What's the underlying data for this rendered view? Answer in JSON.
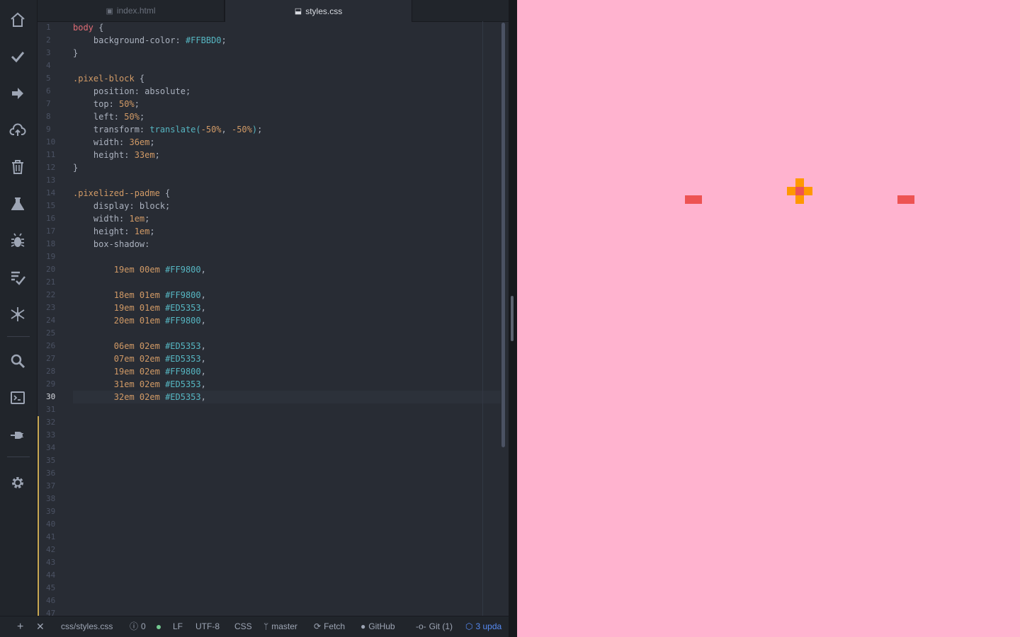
{
  "tabs": [
    {
      "label": "index.html",
      "icon": "html-file-icon",
      "active": false
    },
    {
      "label": "styles.css",
      "icon": "css-file-icon",
      "active": true
    }
  ],
  "activity_icons": [
    "home-icon",
    "check-icon",
    "arrow-right-icon",
    "cloud-upload-icon",
    "trash-icon",
    "flask-icon",
    "bug-icon",
    "checklist-icon",
    "network-icon",
    "search-icon",
    "terminal-icon",
    "plug-icon",
    "gear-icon"
  ],
  "editor": {
    "current_line": 30,
    "line_numbers": [
      "1",
      "2",
      "3",
      "4",
      "5",
      "6",
      "7",
      "8",
      "9",
      "10",
      "11",
      "12",
      "13",
      "14",
      "15",
      "16",
      "17",
      "18",
      "19",
      "20",
      "21",
      "22",
      "23",
      "24",
      "25",
      "26",
      "27",
      "28",
      "29",
      "30",
      "31",
      "32",
      "33",
      "34",
      "35",
      "36",
      "37",
      "38",
      "39",
      "40",
      "41",
      "42",
      "43",
      "44",
      "45",
      "46",
      "47"
    ],
    "lines": [
      [
        {
          "t": "sel",
          "v": "body"
        },
        {
          "t": "p",
          "v": " {"
        }
      ],
      [
        {
          "t": "p",
          "v": "    background-color: "
        },
        {
          "t": "hex",
          "v": "#FFBBD0"
        },
        {
          "t": "p",
          "v": ";"
        }
      ],
      [
        {
          "t": "p",
          "v": "}"
        }
      ],
      [],
      [
        {
          "t": "cls",
          "v": ".pixel-block"
        },
        {
          "t": "p",
          "v": " {"
        }
      ],
      [
        {
          "t": "p",
          "v": "    position: absolute;"
        }
      ],
      [
        {
          "t": "p",
          "v": "    top: "
        },
        {
          "t": "num",
          "v": "50%"
        },
        {
          "t": "p",
          "v": ";"
        }
      ],
      [
        {
          "t": "p",
          "v": "    left: "
        },
        {
          "t": "num",
          "v": "50%"
        },
        {
          "t": "p",
          "v": ";"
        }
      ],
      [
        {
          "t": "p",
          "v": "    transform: "
        },
        {
          "t": "fn",
          "v": "translate("
        },
        {
          "t": "num",
          "v": "-50%"
        },
        {
          "t": "p",
          "v": ", "
        },
        {
          "t": "num",
          "v": "-50%"
        },
        {
          "t": "fn",
          "v": ")"
        },
        {
          "t": "p",
          "v": ";"
        }
      ],
      [
        {
          "t": "p",
          "v": "    width: "
        },
        {
          "t": "num",
          "v": "36em"
        },
        {
          "t": "p",
          "v": ";"
        }
      ],
      [
        {
          "t": "p",
          "v": "    height: "
        },
        {
          "t": "num",
          "v": "33em"
        },
        {
          "t": "p",
          "v": ";"
        }
      ],
      [
        {
          "t": "p",
          "v": "}"
        }
      ],
      [],
      [
        {
          "t": "cls",
          "v": ".pixelized--padme"
        },
        {
          "t": "p",
          "v": " {"
        }
      ],
      [
        {
          "t": "p",
          "v": "    display: block;"
        }
      ],
      [
        {
          "t": "p",
          "v": "    width: "
        },
        {
          "t": "num",
          "v": "1em"
        },
        {
          "t": "p",
          "v": ";"
        }
      ],
      [
        {
          "t": "p",
          "v": "    height: "
        },
        {
          "t": "num",
          "v": "1em"
        },
        {
          "t": "p",
          "v": ";"
        }
      ],
      [
        {
          "t": "p",
          "v": "    box-shadow:"
        }
      ],
      [],
      [
        {
          "t": "p",
          "v": "        "
        },
        {
          "t": "num",
          "v": "19em 00em"
        },
        {
          "t": "p",
          "v": " "
        },
        {
          "t": "hex",
          "v": "#FF9800"
        },
        {
          "t": "p",
          "v": ","
        }
      ],
      [],
      [
        {
          "t": "p",
          "v": "        "
        },
        {
          "t": "num",
          "v": "18em 01em"
        },
        {
          "t": "p",
          "v": " "
        },
        {
          "t": "hex",
          "v": "#FF9800"
        },
        {
          "t": "p",
          "v": ","
        }
      ],
      [
        {
          "t": "p",
          "v": "        "
        },
        {
          "t": "num",
          "v": "19em 01em"
        },
        {
          "t": "p",
          "v": " "
        },
        {
          "t": "hex",
          "v": "#ED5353"
        },
        {
          "t": "p",
          "v": ","
        }
      ],
      [
        {
          "t": "p",
          "v": "        "
        },
        {
          "t": "num",
          "v": "20em 01em"
        },
        {
          "t": "p",
          "v": " "
        },
        {
          "t": "hex",
          "v": "#FF9800"
        },
        {
          "t": "p",
          "v": ","
        }
      ],
      [],
      [
        {
          "t": "p",
          "v": "        "
        },
        {
          "t": "num",
          "v": "06em 02em"
        },
        {
          "t": "p",
          "v": " "
        },
        {
          "t": "hex",
          "v": "#ED5353"
        },
        {
          "t": "p",
          "v": ","
        }
      ],
      [
        {
          "t": "p",
          "v": "        "
        },
        {
          "t": "num",
          "v": "07em 02em"
        },
        {
          "t": "p",
          "v": " "
        },
        {
          "t": "hex",
          "v": "#ED5353"
        },
        {
          "t": "p",
          "v": ","
        }
      ],
      [
        {
          "t": "p",
          "v": "        "
        },
        {
          "t": "num",
          "v": "19em 02em"
        },
        {
          "t": "p",
          "v": " "
        },
        {
          "t": "hex",
          "v": "#FF9800"
        },
        {
          "t": "p",
          "v": ","
        }
      ],
      [
        {
          "t": "p",
          "v": "        "
        },
        {
          "t": "num",
          "v": "31em 02em"
        },
        {
          "t": "p",
          "v": " "
        },
        {
          "t": "hex",
          "v": "#ED5353"
        },
        {
          "t": "p",
          "v": ","
        }
      ],
      [
        {
          "t": "p",
          "v": "        "
        },
        {
          "t": "num",
          "v": "32em 02em"
        },
        {
          "t": "p",
          "v": " "
        },
        {
          "t": "hex",
          "v": "#ED5353"
        },
        {
          "t": "p",
          "v": ","
        }
      ]
    ]
  },
  "preview": {
    "background": "#FFB3CF",
    "pixels": [
      {
        "col": 19,
        "row": 0,
        "color": "#FF9800"
      },
      {
        "col": 18,
        "row": 1,
        "color": "#FF9800"
      },
      {
        "col": 19,
        "row": 1,
        "color": "#ED5353"
      },
      {
        "col": 20,
        "row": 1,
        "color": "#FF9800"
      },
      {
        "col": 6,
        "row": 2,
        "color": "#ED5353"
      },
      {
        "col": 7,
        "row": 2,
        "color": "#ED5353"
      },
      {
        "col": 19,
        "row": 2,
        "color": "#FF9800"
      },
      {
        "col": 31,
        "row": 2,
        "color": "#ED5353"
      },
      {
        "col": 32,
        "row": 2,
        "color": "#ED5353"
      }
    ]
  },
  "status": {
    "file_path": "css/styles.css",
    "problems": "0",
    "line_ending": "LF",
    "encoding": "UTF-8",
    "grammar": "CSS",
    "branch": "master",
    "fetch": "Fetch",
    "github": "GitHub",
    "git": "Git (1)",
    "updates": "3 upda"
  }
}
